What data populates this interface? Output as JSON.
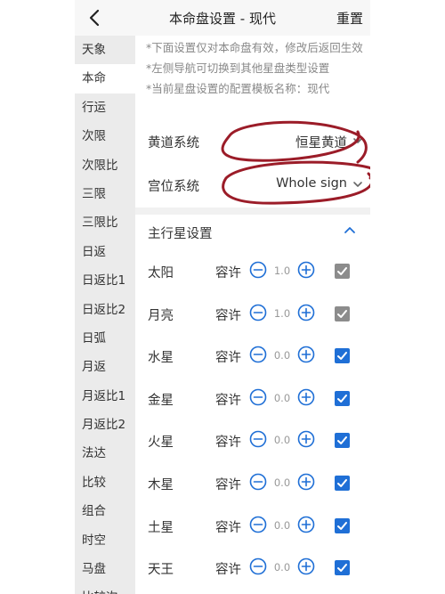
{
  "header": {
    "title": "本命盘设置 - 现代",
    "reset_label": "重置"
  },
  "sidebar": {
    "active_index": 1,
    "items": [
      "天象",
      "本命",
      "行运",
      "次限",
      "次限比",
      "三限",
      "三限比",
      "日返",
      "日返比1",
      "日返比2",
      "日弧",
      "月返",
      "月返比1",
      "月返比2",
      "法达",
      "比较",
      "组合",
      "时空",
      "马盘",
      "比较次"
    ]
  },
  "notes": [
    "*下面设置仅对本命盘有效，修改后返回生效",
    "*左侧导航可切换到其他星盘类型设置",
    "*当前星盘设置的配置模板名称：现代"
  ],
  "settings": {
    "zodiac": {
      "label": "黄道系统",
      "value": "恒星黄道"
    },
    "house": {
      "label": "宫位系统",
      "value": "Whole sign"
    }
  },
  "section": {
    "title": "主行星设置"
  },
  "planets": [
    {
      "name": "太阳",
      "tol_label": "容许",
      "value": "1.0",
      "checked": true,
      "enabled": false
    },
    {
      "name": "月亮",
      "tol_label": "容许",
      "value": "1.0",
      "checked": true,
      "enabled": false
    },
    {
      "name": "水星",
      "tol_label": "容许",
      "value": "0.0",
      "checked": true,
      "enabled": true
    },
    {
      "name": "金星",
      "tol_label": "容许",
      "value": "0.0",
      "checked": true,
      "enabled": true
    },
    {
      "name": "火星",
      "tol_label": "容许",
      "value": "0.0",
      "checked": true,
      "enabled": true
    },
    {
      "name": "木星",
      "tol_label": "容许",
      "value": "0.0",
      "checked": true,
      "enabled": true
    },
    {
      "name": "土星",
      "tol_label": "容许",
      "value": "0.0",
      "checked": true,
      "enabled": true
    },
    {
      "name": "天王",
      "tol_label": "容许",
      "value": "0.0",
      "checked": true,
      "enabled": true
    }
  ],
  "colors": {
    "accent": "#1f6fd6",
    "checkbox_checked": "#1f6fd6",
    "checkbox_disabled": "#8c8c8c",
    "annotation": "#9b1c28"
  },
  "icons": {
    "back": "chevron-left-icon",
    "dropdown": "chevron-down-icon",
    "collapse": "chevron-up-icon",
    "minus": "minus-circle-icon",
    "plus": "plus-circle-icon",
    "check": "check-icon"
  }
}
